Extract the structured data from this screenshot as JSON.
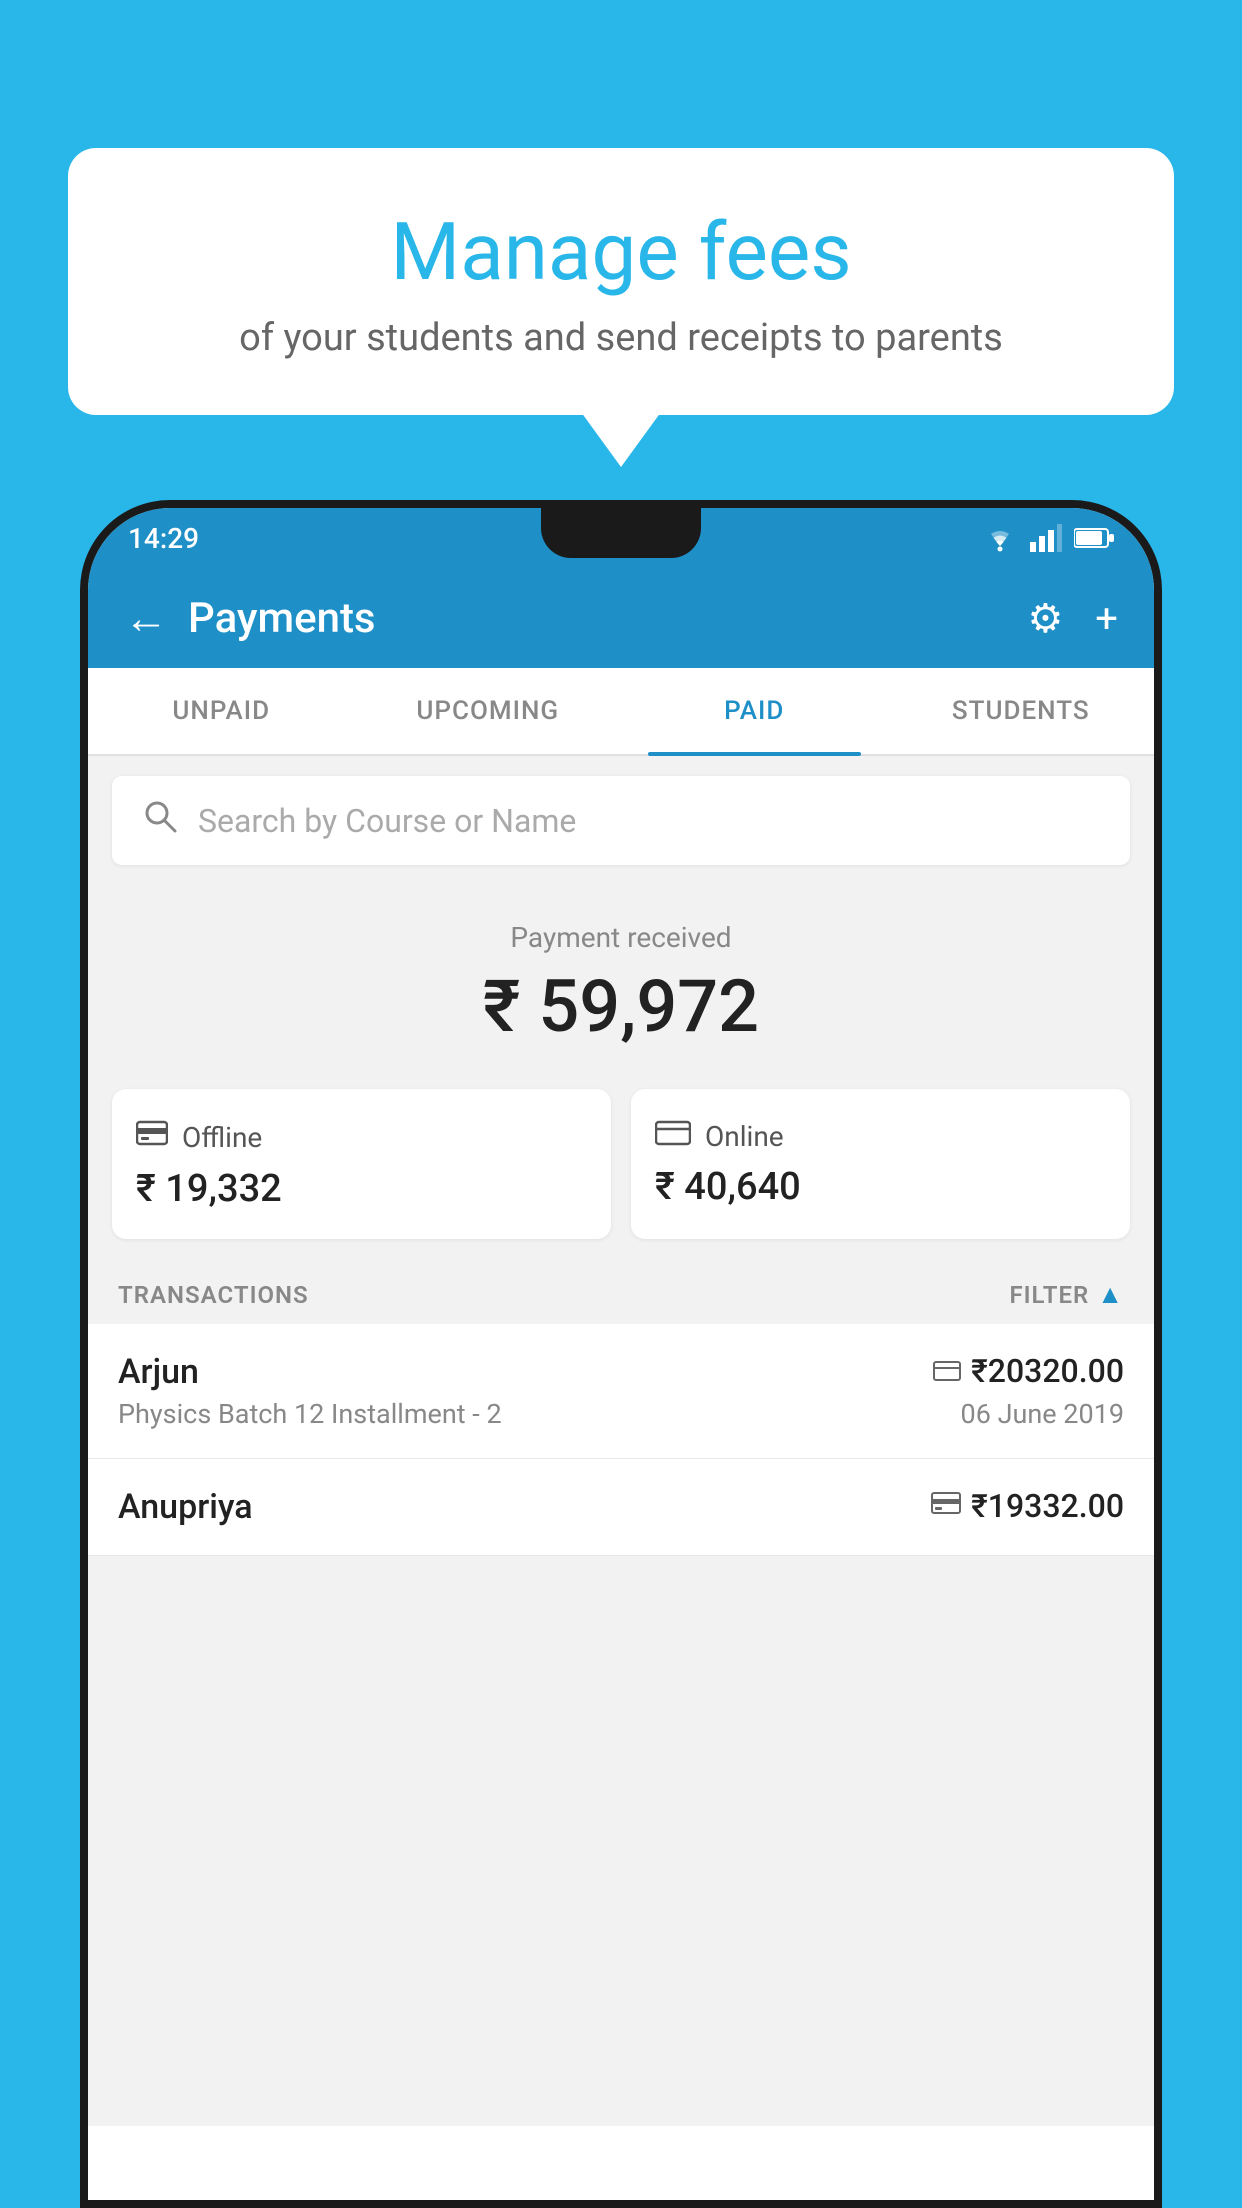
{
  "background_color": "#29b6e8",
  "tooltip": {
    "title": "Manage fees",
    "subtitle": "of your students and send receipts to parents"
  },
  "phone": {
    "status_bar": {
      "time": "14:29",
      "icons": [
        "wifi",
        "signal",
        "battery"
      ]
    },
    "header": {
      "title": "Payments",
      "back_icon": "←",
      "settings_icon": "⚙",
      "add_icon": "+"
    },
    "tabs": [
      {
        "label": "UNPAID",
        "active": false
      },
      {
        "label": "UPCOMING",
        "active": false
      },
      {
        "label": "PAID",
        "active": true
      },
      {
        "label": "STUDENTS",
        "active": false
      }
    ],
    "search": {
      "placeholder": "Search by Course or Name"
    },
    "payment_summary": {
      "label": "Payment received",
      "amount": "₹ 59,972",
      "offline": {
        "label": "Offline",
        "amount": "₹ 19,332"
      },
      "online": {
        "label": "Online",
        "amount": "₹ 40,640"
      }
    },
    "transactions": {
      "section_label": "TRANSACTIONS",
      "filter_label": "FILTER",
      "items": [
        {
          "name": "Arjun",
          "detail": "Physics Batch 12 Installment - 2",
          "amount": "₹20320.00",
          "date": "06 June 2019",
          "payment_type": "online"
        },
        {
          "name": "Anupriya",
          "detail": "",
          "amount": "₹19332.00",
          "date": "",
          "payment_type": "offline"
        }
      ]
    }
  }
}
